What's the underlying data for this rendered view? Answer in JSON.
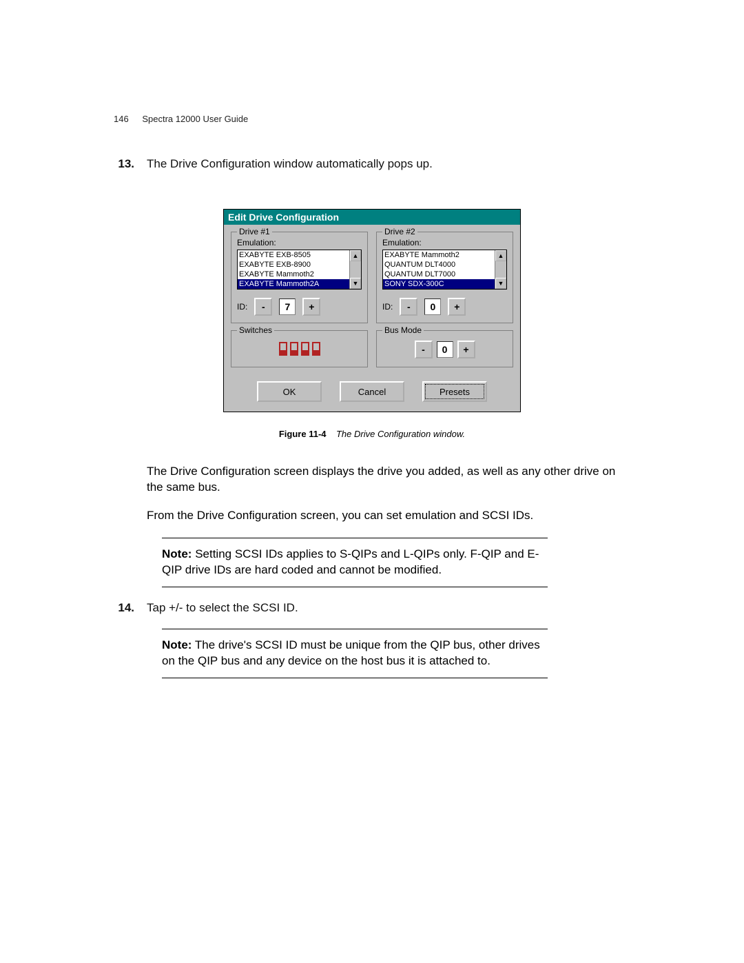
{
  "header": {
    "page_number": "146",
    "title": "Spectra 12000 User Guide"
  },
  "steps": {
    "s13": {
      "num": "13.",
      "text": "The Drive Configuration window automatically pops up."
    },
    "s14": {
      "num": "14.",
      "text": "Tap +/- to select the SCSI ID."
    }
  },
  "dialog": {
    "title": "Edit Drive Configuration",
    "drive1": {
      "legend": "Drive #1",
      "emulation_label": "Emulation:",
      "items": [
        "EXABYTE EXB-8505",
        "EXABYTE EXB-8900",
        "EXABYTE Mammoth2",
        "EXABYTE Mammoth2A"
      ],
      "selected_index": 3,
      "id_label": "ID:",
      "id_value": "7"
    },
    "drive2": {
      "legend": "Drive #2",
      "emulation_label": "Emulation:",
      "items": [
        "EXABYTE Mammoth2",
        "QUANTUM DLT4000",
        "QUANTUM DLT7000",
        "SONY    SDX-300C"
      ],
      "selected_index": 3,
      "id_label": "ID:",
      "id_value": "0"
    },
    "switches": {
      "legend": "Switches",
      "count": 4
    },
    "busmode": {
      "legend": "Bus Mode",
      "value": "0"
    },
    "buttons": {
      "ok": "OK",
      "cancel": "Cancel",
      "presets": "Presets"
    },
    "minus": "-",
    "plus": "+"
  },
  "figure": {
    "label": "Figure 11-4",
    "caption": "The Drive Configuration window."
  },
  "body": {
    "p1": "The Drive Configuration screen displays the drive you added, as well as any other drive on the same bus.",
    "p2": "From the Drive Configuration screen, you can set emulation and SCSI IDs."
  },
  "notes": {
    "label": "Note:",
    "n1": "Setting SCSI IDs applies to S-QIPs and L-QIPs only. F-QIP and E-QIP drive IDs are hard coded and cannot be modified.",
    "n2": "The drive's SCSI ID must be unique from the QIP bus, other drives on the QIP bus and any device on the host bus it is attached to."
  }
}
